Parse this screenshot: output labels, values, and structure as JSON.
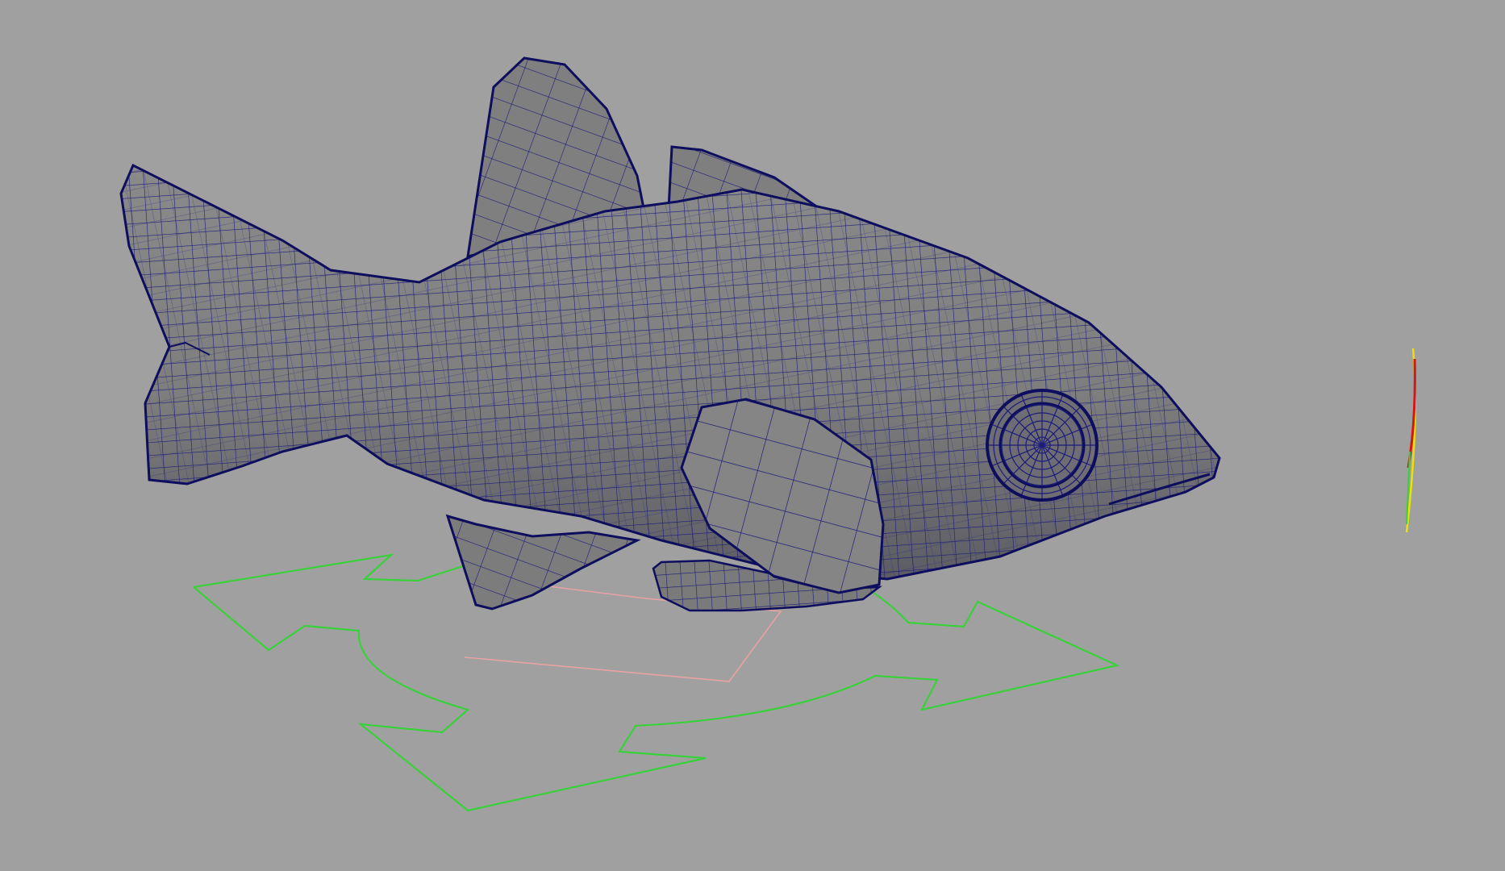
{
  "viewport": {
    "background_color": "#a0a0a0",
    "scene": {
      "mesh": {
        "object": "fish",
        "display": "wireframe-on-shaded",
        "surface_color": "#7f7f7f",
        "wireframe_color": "#1c1c7a",
        "edge_color": "#0e0e5e"
      },
      "controls": [
        {
          "type": "move-rig-control",
          "shape": "four-arrow-curve",
          "color": "#39d13a"
        },
        {
          "type": "root-locator",
          "shape": "square",
          "color": "#e8a2a2"
        },
        {
          "type": "side-curve-control",
          "colors": [
            "#f0e000",
            "#d01818",
            "#39d13a"
          ]
        }
      ]
    }
  }
}
